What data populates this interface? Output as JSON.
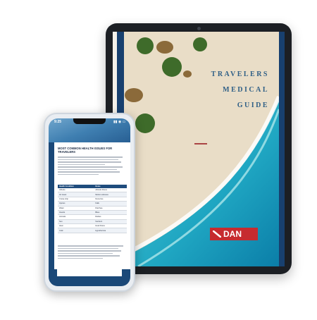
{
  "tablet": {
    "cover_title_lines": [
      "TRAVELERS",
      "MEDICAL",
      "GUIDE"
    ],
    "logo_text": "DAN"
  },
  "phone": {
    "status_time": "9:25",
    "status_icons": "▮▮ ◉ ▭",
    "heading": "MOST COMMON HEALTH ISSUES FOR TRAVELERS",
    "table": {
      "headers": [
        "Health Condition",
        "Notes"
      ],
      "rows": [
        [
          "Altitude",
          "Altitude illness"
        ],
        [
          "Air travel",
          "Motion sickness"
        ],
        [
          "Cruise ship",
          "Norovirus"
        ],
        [
          "Injuries",
          "Falls"
        ],
        [
          "Water",
          "Diarrhea"
        ],
        [
          "Insects",
          "Bites"
        ],
        [
          "Animals",
          "Rabies"
        ],
        [
          "Sun",
          "Sunburn"
        ],
        [
          "Heat",
          "Heat illness"
        ],
        [
          "Cold",
          "Hypothermia"
        ]
      ]
    }
  }
}
